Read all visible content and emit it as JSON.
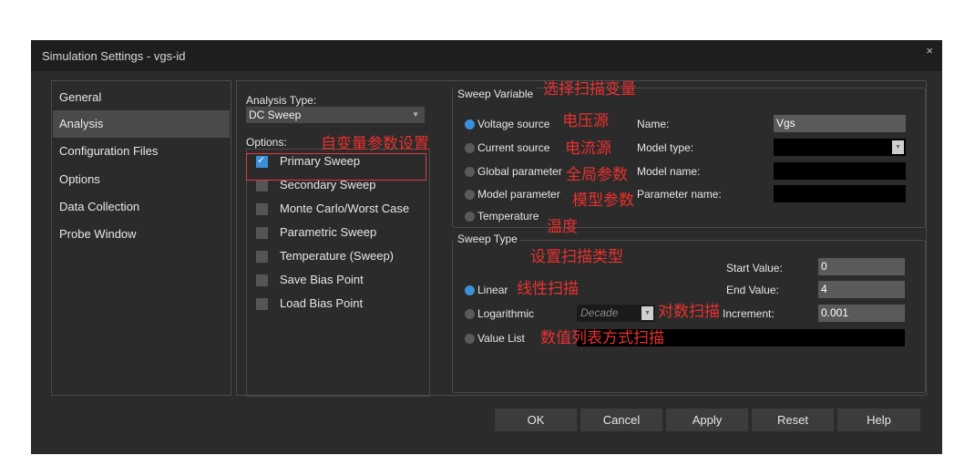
{
  "window": {
    "title": "Simulation Settings - vgs-id",
    "close_icon": "×"
  },
  "sidebar": {
    "items": [
      {
        "label": "General",
        "active": false
      },
      {
        "label": "Analysis",
        "active": true
      },
      {
        "label": "Configuration Files",
        "active": false
      },
      {
        "label": "Options",
        "active": false
      },
      {
        "label": "Data Collection",
        "active": false
      },
      {
        "label": "Probe Window",
        "active": false
      }
    ]
  },
  "analysis": {
    "type_label": "Analysis Type:",
    "type_value": "DC Sweep",
    "options_label": "Options:",
    "options": [
      {
        "label": "Primary Sweep",
        "checked": true
      },
      {
        "label": "Secondary Sweep",
        "checked": false
      },
      {
        "label": "Monte Carlo/Worst Case",
        "checked": false
      },
      {
        "label": "Parametric Sweep",
        "checked": false
      },
      {
        "label": "Temperature (Sweep)",
        "checked": false
      },
      {
        "label": "Save Bias Point",
        "checked": false
      },
      {
        "label": "Load Bias Point",
        "checked": false
      }
    ]
  },
  "sweep_variable": {
    "title": "Sweep Variable",
    "options": [
      {
        "label": "Voltage source",
        "selected": true
      },
      {
        "label": "Current source",
        "selected": false
      },
      {
        "label": "Global parameter",
        "selected": false
      },
      {
        "label": "Model parameter",
        "selected": false
      },
      {
        "label": "Temperature",
        "selected": false
      }
    ],
    "name_label": "Name:",
    "name_value": "Vgs",
    "model_type_label": "Model type:",
    "model_type_value": "",
    "model_name_label": "Model name:",
    "model_name_value": "",
    "parameter_name_label": "Parameter name:",
    "parameter_name_value": ""
  },
  "sweep_type": {
    "title": "Sweep Type",
    "options": [
      {
        "label": "Linear",
        "selected": true
      },
      {
        "label": "Logarithmic",
        "selected": false
      },
      {
        "label": "Value List",
        "selected": false
      }
    ],
    "log_scale_value": "Decade",
    "start_label": "Start Value:",
    "start_value": "0",
    "end_label": "End Value:",
    "end_value": "4",
    "increment_label": "Increment:",
    "increment_value": "0.001",
    "value_list_value": ""
  },
  "annotations": {
    "select_sweep_var": "选择扫描变量",
    "independent_var_settings": "自变量参数设置",
    "voltage_source": "电压源",
    "current_source": "电流源",
    "global_param": "全局参数",
    "model_param": "模型参数",
    "temperature": "温度",
    "set_sweep_type": "设置扫描类型",
    "linear_sweep": "线性扫描",
    "log_sweep": "对数扫描",
    "value_list_sweep": "数值列表方式扫描"
  },
  "buttons": {
    "ok": "OK",
    "cancel": "Cancel",
    "apply": "Apply",
    "reset": "Reset",
    "help": "Help"
  },
  "colors": {
    "accent": "#3a8fd8",
    "annotation": "#e8312f",
    "background": "#2b2b2b"
  }
}
